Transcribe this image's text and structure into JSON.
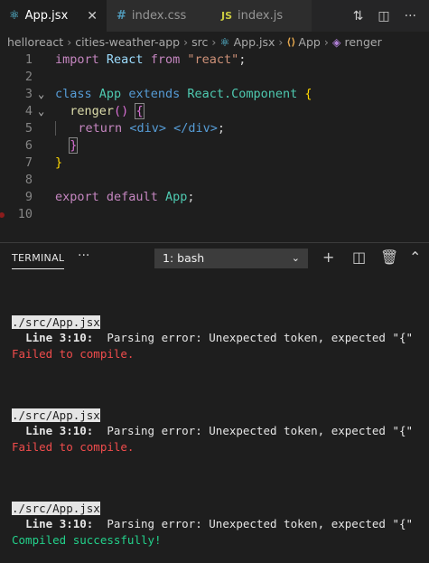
{
  "tabs": [
    {
      "icon": "",
      "label": "App.jsx",
      "active": true
    },
    {
      "icon": "#",
      "label": "index.css",
      "active": false
    },
    {
      "icon": "JS",
      "label": "index.js",
      "active": false
    }
  ],
  "breadcrumb": [
    "helloreact",
    "cities-weather-app",
    "src",
    "App.jsx",
    "App",
    "renger"
  ],
  "editor": {
    "line_numbers": [
      "1",
      "2",
      "3",
      "4",
      "5",
      "6",
      "7",
      "8",
      "9",
      "10"
    ],
    "l1": {
      "kw": "import",
      "id": "React",
      "from": "from",
      "str": "\"react\"",
      "semi": ";"
    },
    "l3": {
      "kw": "class",
      "name": "App",
      "ext": "extends",
      "base": "React.Component",
      "brace": "{"
    },
    "l4": {
      "fn": "renger",
      "paren": "()",
      "brace": "{"
    },
    "l5": {
      "kw": "return",
      "open": "<div>",
      "close": "</div>",
      "semi": ";"
    },
    "l6": {
      "brace": "}"
    },
    "l7": {
      "brace": "}"
    },
    "l9": {
      "kw1": "export",
      "kw2": "default",
      "name": "App",
      "semi": ";"
    }
  },
  "panel": {
    "tab": "TERMINAL",
    "more": "···",
    "shell_select": "1: bash"
  },
  "terminal": [
    {
      "file": "./src/App.jsx",
      "detail_label": "Line 3:10:",
      "detail_msg": "  Parsing error: Unexpected token, expected \"{\"",
      "status": "Failed to compile.",
      "status_type": "error"
    },
    {
      "file": "./src/App.jsx",
      "detail_label": "Line 3:10:",
      "detail_msg": "  Parsing error: Unexpected token, expected \"{\"",
      "status": "Failed to compile.",
      "status_type": "error"
    },
    {
      "file": "./src/App.jsx",
      "detail_label": "Line 3:10:",
      "detail_msg": "  Parsing error: Unexpected token, expected \"{\"",
      "status": "Compiled successfully!",
      "status_type": "success"
    }
  ],
  "colors": {
    "error": "#f14c4c",
    "success": "#23d18b",
    "accent_js": "#cbcb41"
  }
}
